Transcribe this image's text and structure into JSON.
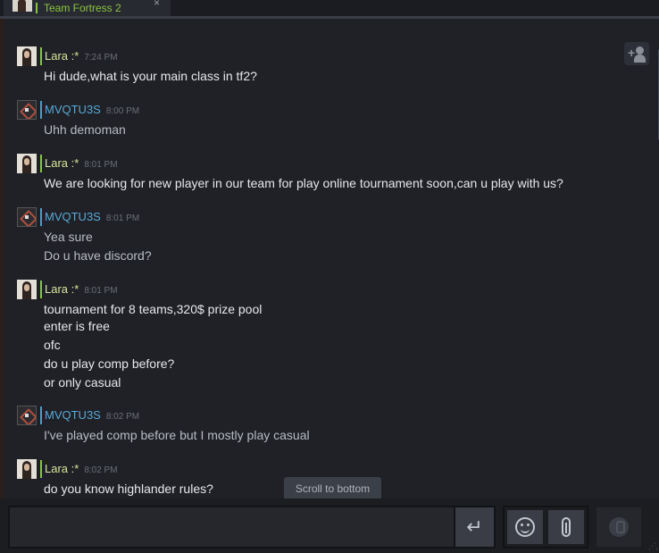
{
  "tab": {
    "label": "Team Fortress 2",
    "close": "×"
  },
  "add_friend": {
    "plus": "+"
  },
  "messages": [
    {
      "sender": "Lara :*",
      "time": "7:24 PM",
      "lines": [
        "Hi dude,what is your main class in tf2?"
      ]
    },
    {
      "sender": "MVQTU3S",
      "time": "8:00 PM",
      "lines": [
        "Uhh demoman"
      ]
    },
    {
      "sender": "Lara :*",
      "time": "8:01 PM",
      "lines": [
        "We are looking for new player in our team for play online tournament soon,can u play with us?"
      ]
    },
    {
      "sender": "MVQTU3S",
      "time": "8:01 PM",
      "lines": [
        "Yea sure",
        "Do u have discord?"
      ]
    },
    {
      "sender": "Lara :*",
      "time": "8:01 PM",
      "lines": [
        "tournament for 8 teams,320$ prize pool",
        "enter is free",
        "ofc",
        "do u play comp before?",
        "or only casual"
      ]
    },
    {
      "sender": "MVQTU3S",
      "time": "8:02 PM",
      "lines": [
        "I've played comp before but I mostly play casual"
      ]
    },
    {
      "sender": "Lara :*",
      "time": "8:02 PM",
      "lines": [
        "do you know highlander rules?"
      ]
    }
  ],
  "scroll_to_bottom": "Scroll to bottom",
  "input": {
    "value": "",
    "send_icon": "↵"
  },
  "colors": {
    "online": "#8bc53f",
    "self": "#4b9dc9",
    "background": "#1f2126"
  }
}
